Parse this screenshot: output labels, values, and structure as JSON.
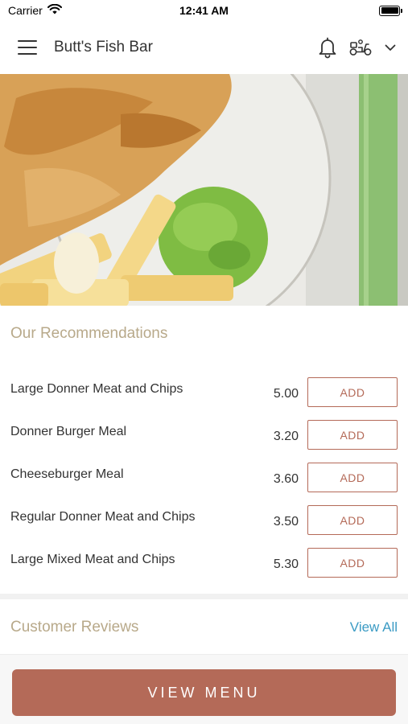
{
  "status_bar": {
    "carrier": "Carrier",
    "time": "12:41 AM",
    "wifi_icon": "wifi-icon",
    "battery_icon": "battery-icon"
  },
  "header": {
    "title": "Butt's Fish Bar",
    "menu_icon": "hamburger-menu-icon",
    "bell_icon": "bell-icon",
    "delivery_icon": "scooter-icon",
    "chevron_icon": "chevron-down-icon"
  },
  "hero": {
    "image": "fish-and-chips-with-mushy-peas-photo"
  },
  "recommendations": {
    "title": "Our Recommendations",
    "add_label": "ADD",
    "items": [
      {
        "name": "Large Donner Meat and Chips",
        "price": "5.00"
      },
      {
        "name": "Donner Burger Meal",
        "price": "3.20"
      },
      {
        "name": "Cheeseburger Meal",
        "price": "3.60"
      },
      {
        "name": "Regular Donner Meat and Chips",
        "price": "3.50"
      },
      {
        "name": "Large Mixed Meat and Chips",
        "price": "5.30"
      }
    ]
  },
  "reviews": {
    "title": "Customer Reviews",
    "view_all": "View All"
  },
  "footer": {
    "view_menu": "VIEW MENU"
  },
  "colors": {
    "accent": "#b46a58",
    "section_title": "#b8a98a",
    "link": "#3b9bc4"
  }
}
